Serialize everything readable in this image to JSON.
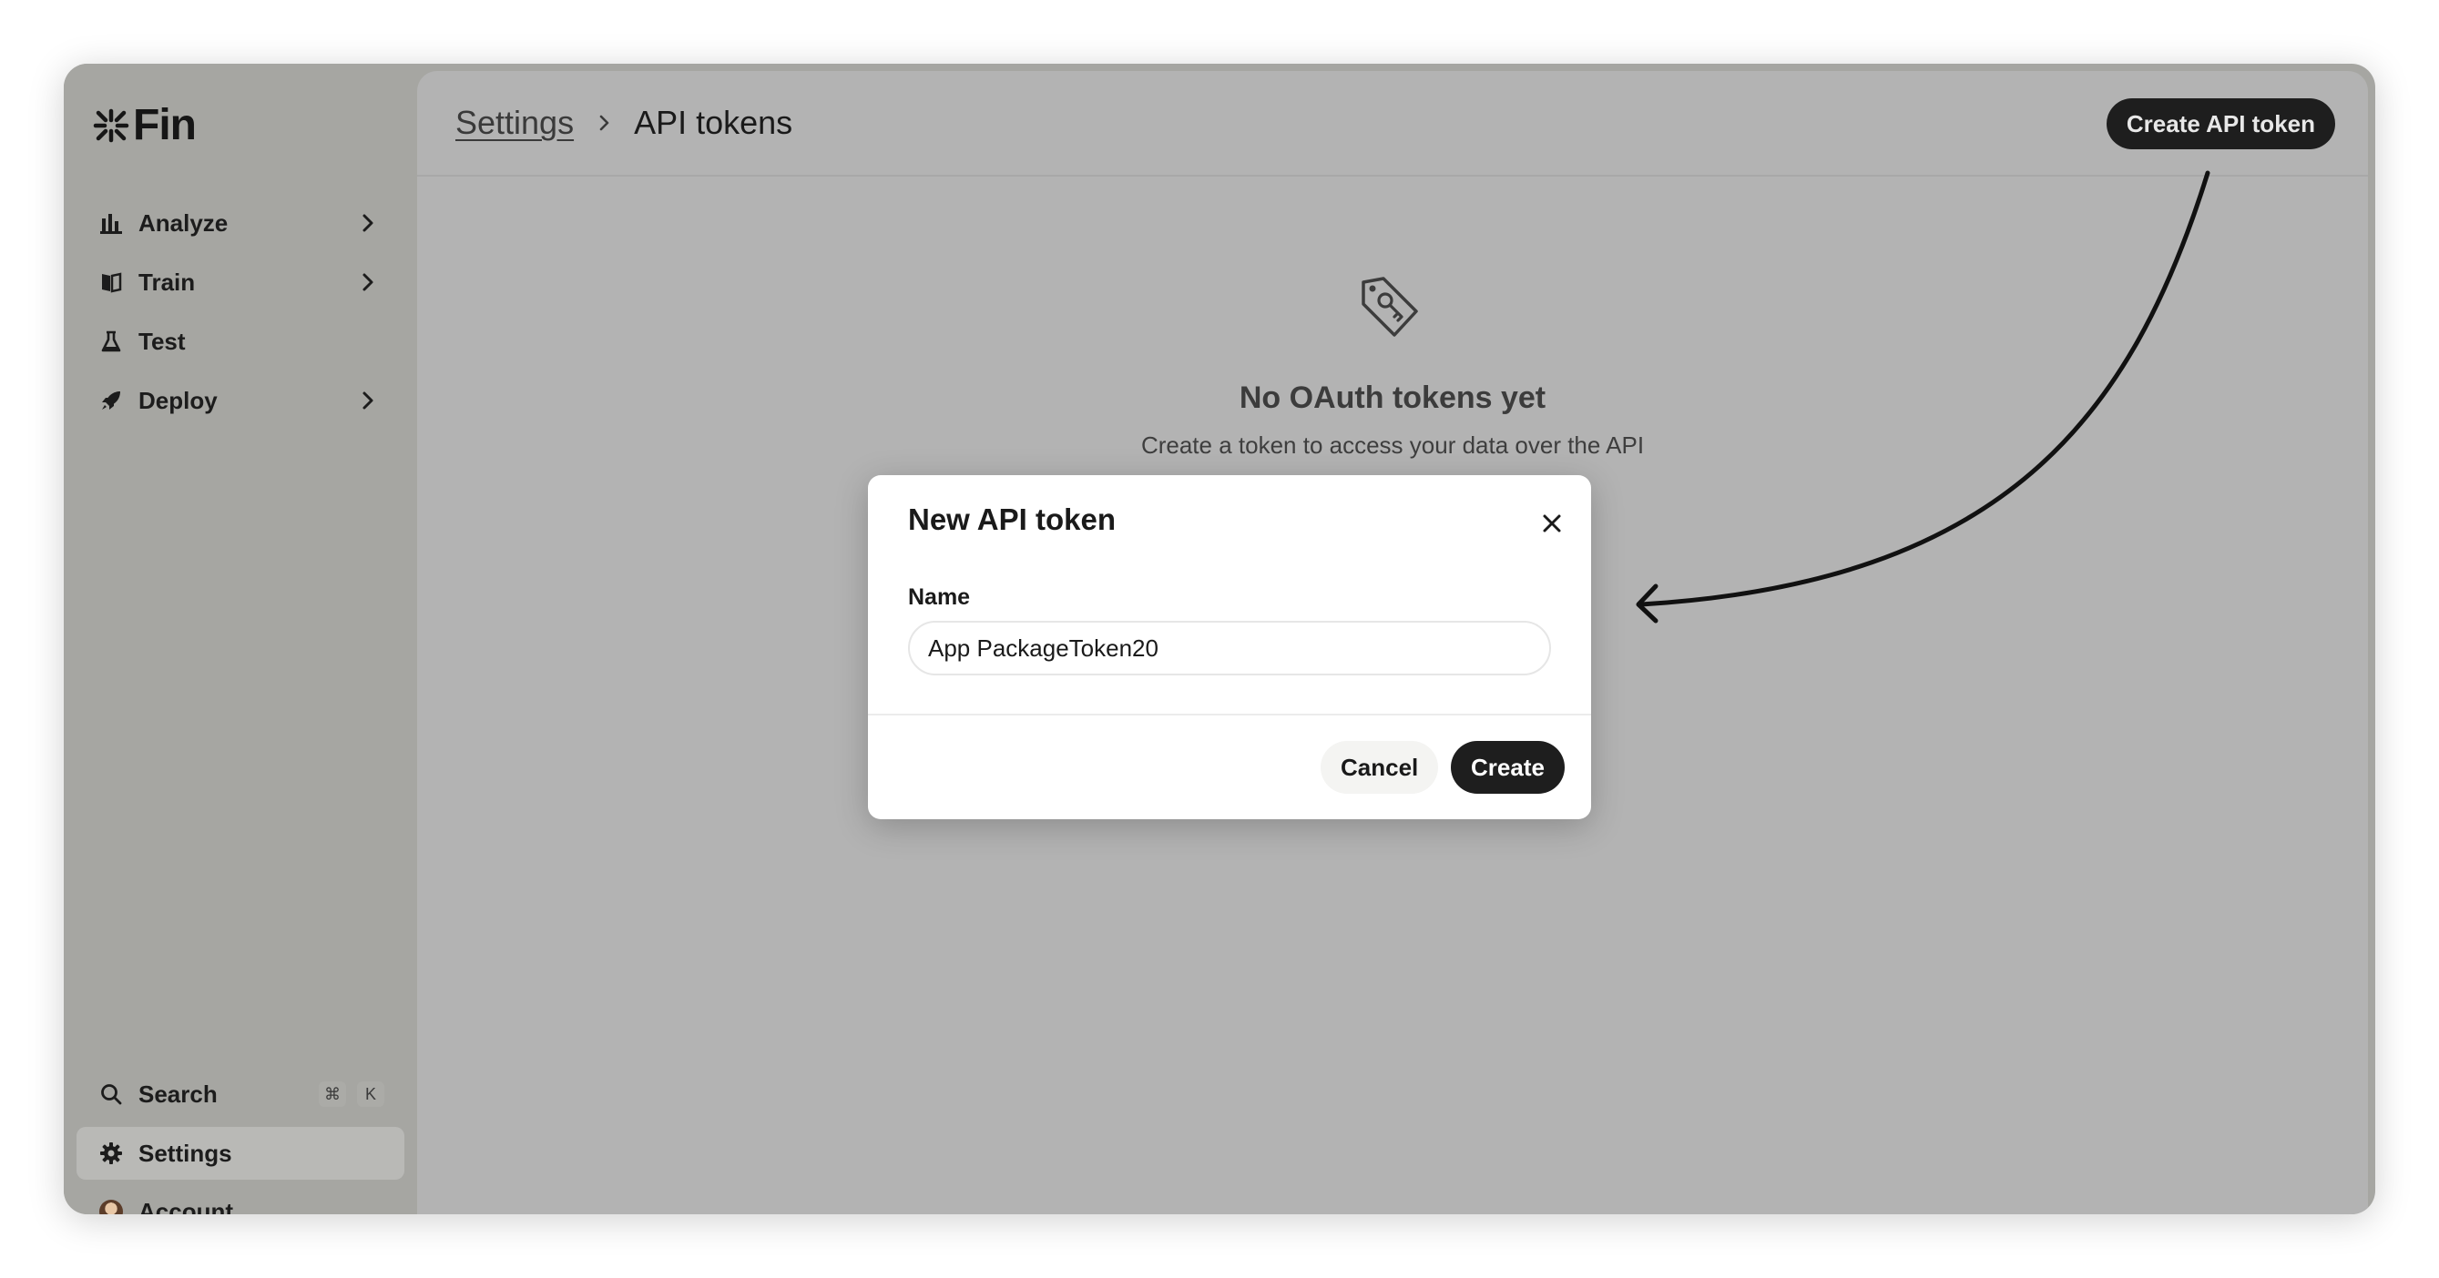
{
  "app": {
    "name": "Fin"
  },
  "sidebar": {
    "items": [
      {
        "label": "Analyze",
        "icon": "bar-chart-icon",
        "has_submenu": true
      },
      {
        "label": "Train",
        "icon": "book-icon",
        "has_submenu": true
      },
      {
        "label": "Test",
        "icon": "flask-icon",
        "has_submenu": false
      },
      {
        "label": "Deploy",
        "icon": "rocket-icon",
        "has_submenu": true
      }
    ],
    "bottom": {
      "search_label": "Search",
      "search_shortcut_mod": "⌘",
      "search_shortcut_key": "K",
      "settings_label": "Settings",
      "account_label": "Account"
    }
  },
  "header": {
    "breadcrumb_parent": "Settings",
    "breadcrumb_current": "API tokens",
    "create_button": "Create API token"
  },
  "empty_state": {
    "icon": "tag-key-icon",
    "title": "No OAuth tokens yet",
    "subtitle": "Create a token to access your data over the API"
  },
  "modal": {
    "title": "New API token",
    "name_label": "Name",
    "name_value": "App PackageToken20",
    "cancel_label": "Cancel",
    "create_label": "Create"
  },
  "colors": {
    "overlay": "#b3b3b3",
    "sidebar": "#a6a6a2",
    "primary_button": "#1e1e1e"
  }
}
